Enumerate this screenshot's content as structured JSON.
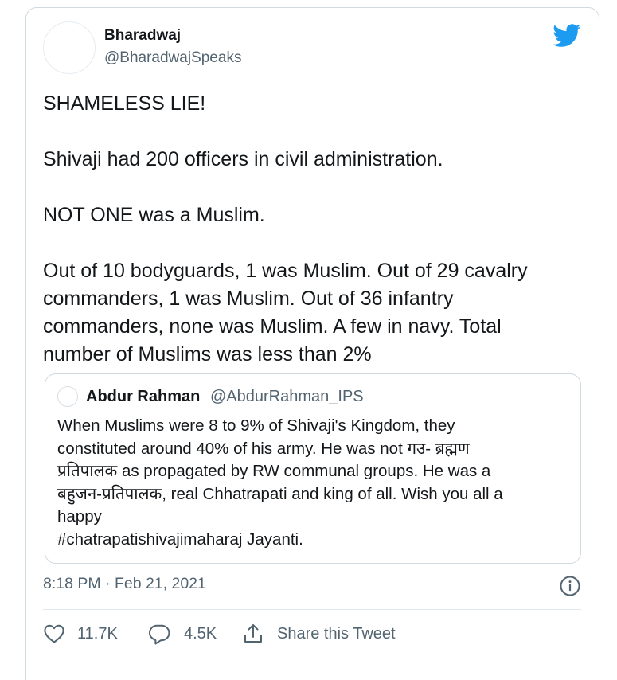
{
  "author": {
    "name": "Bharadwaj",
    "handle": "@BharadwajSpeaks"
  },
  "tweet": {
    "lines": [
      "SHAMELESS LIE!",
      "",
      "Shivaji had 200 officers in civil administration.",
      "",
      "NOT ONE was a Muslim.",
      "",
      "Out of 10 bodyguards, 1 was Muslim. Out of 29 cavalry",
      "commanders, 1 was Muslim. Out of 36 infantry",
      "commanders, none was Muslim. A few in navy. Total",
      "number of Muslims was less than 2%"
    ]
  },
  "quoted_tweet": {
    "name": "Abdur Rahman",
    "handle": "@AbdurRahman_IPS",
    "lines": [
      "When Muslims were 8 to 9% of Shivaji's Kingdom, they",
      "constituted around 40% of his army. He was not  गउ- ब्रह्मण",
      "प्रतिपालक as propagated by RW communal groups. He was a",
      "बहुजन-प्रतिपालक, real Chhatrapati and king of all. Wish you all a",
      "happy",
      "#chatrapatishivajimaharaj Jayanti."
    ]
  },
  "meta": {
    "timestamp": "8:18 PM · Feb 21, 2021"
  },
  "actions": {
    "likes": "11.7K",
    "replies": "4.5K",
    "share_label": "Share this Tweet"
  },
  "icons": {
    "brand": "twitter-bird-icon",
    "info": "info-icon",
    "like": "heart-icon",
    "reply": "reply-bubble-icon",
    "share": "share-icon"
  },
  "colors": {
    "twitter_blue": "#1d9bf0",
    "secondary_text": "#536471",
    "border": "#cfd9de"
  }
}
